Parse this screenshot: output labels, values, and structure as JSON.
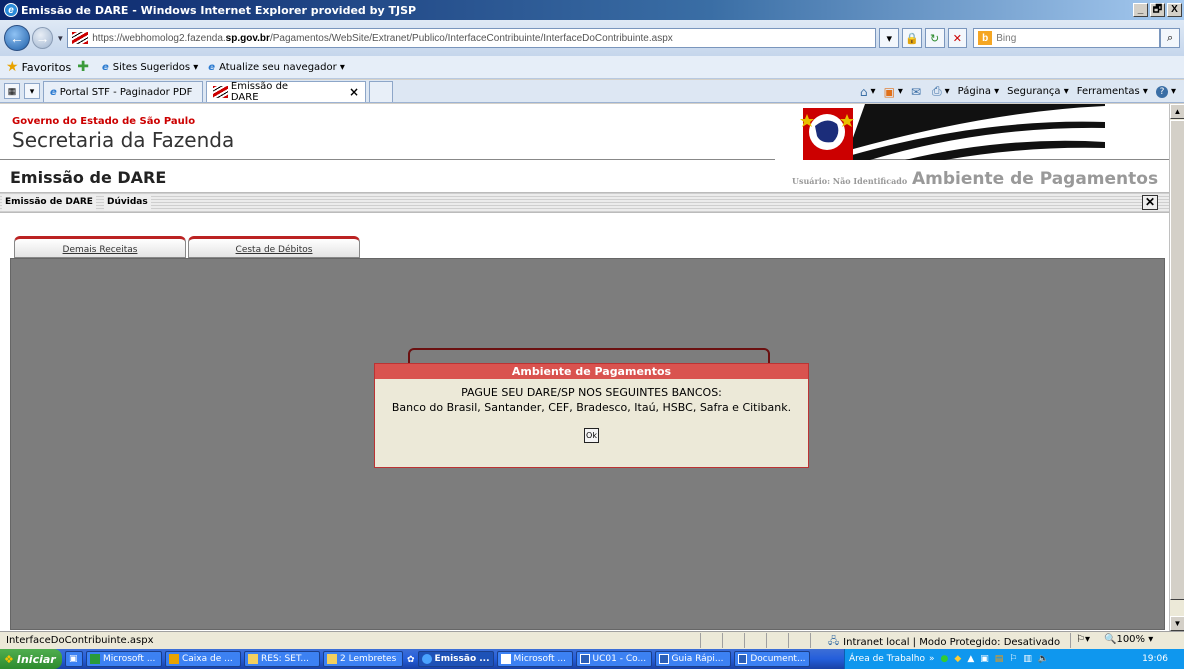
{
  "window": {
    "title": "Emissão de DARE - Windows Internet Explorer provided by TJSP",
    "buttons": [
      "_",
      "🗗",
      "X"
    ]
  },
  "address_bar": {
    "url_scheme_host_prefix": "https://webhomolog2.fazenda.",
    "url_host_bold": "sp.gov.br",
    "url_path": "/Pagamentos/WebSite/Extranet/Publico/InterfaceContribuinte/InterfaceDoContribuinte.aspx",
    "search_placeholder": "Bing"
  },
  "favorites_bar": {
    "favorites_label": "Favoritos",
    "items": [
      "Sites Sugeridos ▾",
      "Atualize seu navegador ▾"
    ]
  },
  "tabs": [
    {
      "label": "Portal STF - Paginador PDF",
      "active": false
    },
    {
      "label": "Emissão de DARE",
      "active": true
    }
  ],
  "command_bar": [
    "Página ▾",
    "Segurança ▾",
    "Ferramentas ▾"
  ],
  "page": {
    "gov_line": "Governo do Estado de São Paulo",
    "sec_line": "Secretaria da Fazenda",
    "title": "Emissão de DARE",
    "user_label": "Usuário: Não Identificado",
    "env_title": "Ambiente de Pagamentos",
    "menu": [
      "Emissão de DARE",
      "Dúvidas"
    ],
    "content_tabs": [
      "Demais Receitas",
      "Cesta de Débitos"
    ]
  },
  "dialog": {
    "title": "Ambiente de Pagamentos",
    "line1": "PAGUE SEU DARE/SP NOS SEGUINTES BANCOS:",
    "line2": "Banco do Brasil, Santander, CEF, Bradesco, Itaú, HSBC, Safra e Citibank.",
    "ok_label": "Ok"
  },
  "status_bar": {
    "text": "InterfaceDoContribuinte.aspx",
    "zone": "Intranet local | Modo Protegido: Desativado",
    "zoom": "100%"
  },
  "taskbar": {
    "start": "Iniciar",
    "items": [
      {
        "label": "Microsoft ...",
        "active": false
      },
      {
        "label": "Caixa de ...",
        "active": false
      },
      {
        "label": "RES: SET...",
        "active": false
      },
      {
        "label": "2 Lembretes",
        "active": false
      },
      {
        "label": "Emissão ...",
        "active": true
      },
      {
        "label": "Microsoft ...",
        "active": false
      },
      {
        "label": "UC01 - Co...",
        "active": false
      },
      {
        "label": "Guia Rápi...",
        "active": false
      },
      {
        "label": "Document...",
        "active": false
      }
    ],
    "desktop_label": "Área de Trabalho",
    "clock": "19:06"
  }
}
